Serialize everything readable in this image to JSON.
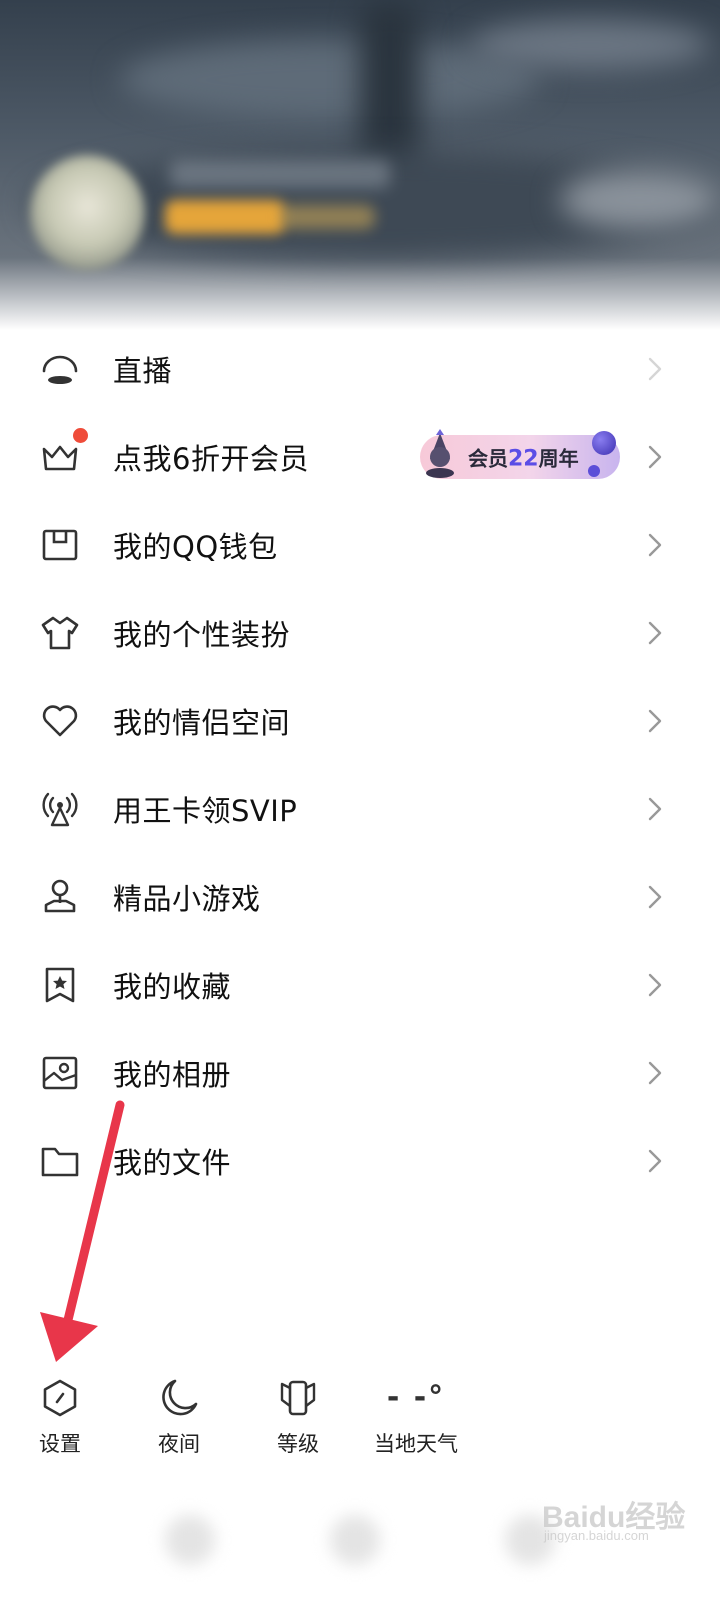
{
  "menu": {
    "items": [
      {
        "label": "直播",
        "icon": "live-icon"
      },
      {
        "label": "点我6折开会员",
        "icon": "crown-icon",
        "badge_dot": true,
        "promo": {
          "text_prefix": "会员",
          "text_number": "22",
          "text_suffix": "周年"
        }
      },
      {
        "label": "我的QQ钱包",
        "icon": "wallet-icon"
      },
      {
        "label": "我的个性装扮",
        "icon": "shirt-icon"
      },
      {
        "label": "我的情侣空间",
        "icon": "heart-icon"
      },
      {
        "label": "用王卡领SVIP",
        "icon": "signal-tower-icon"
      },
      {
        "label": "精品小游戏",
        "icon": "game-icon"
      },
      {
        "label": "我的收藏",
        "icon": "bookmark-star-icon"
      },
      {
        "label": "我的相册",
        "icon": "photo-album-icon"
      },
      {
        "label": "我的文件",
        "icon": "folder-icon"
      }
    ]
  },
  "toolbar": {
    "settings": {
      "label": "设置",
      "icon": "settings-hexagon-icon"
    },
    "night": {
      "label": "夜间",
      "icon": "moon-icon"
    },
    "level": {
      "label": "等级",
      "icon": "level-badge-icon"
    },
    "weather": {
      "label": "当地天气",
      "value": "- -°"
    }
  },
  "watermark": {
    "main": "Baidu经验",
    "sub": "jingyan.baidu.com"
  },
  "colors": {
    "accent_red": "#e8364a",
    "badge_red": "#ef4c3a",
    "vip_number": "#5b4de6"
  }
}
